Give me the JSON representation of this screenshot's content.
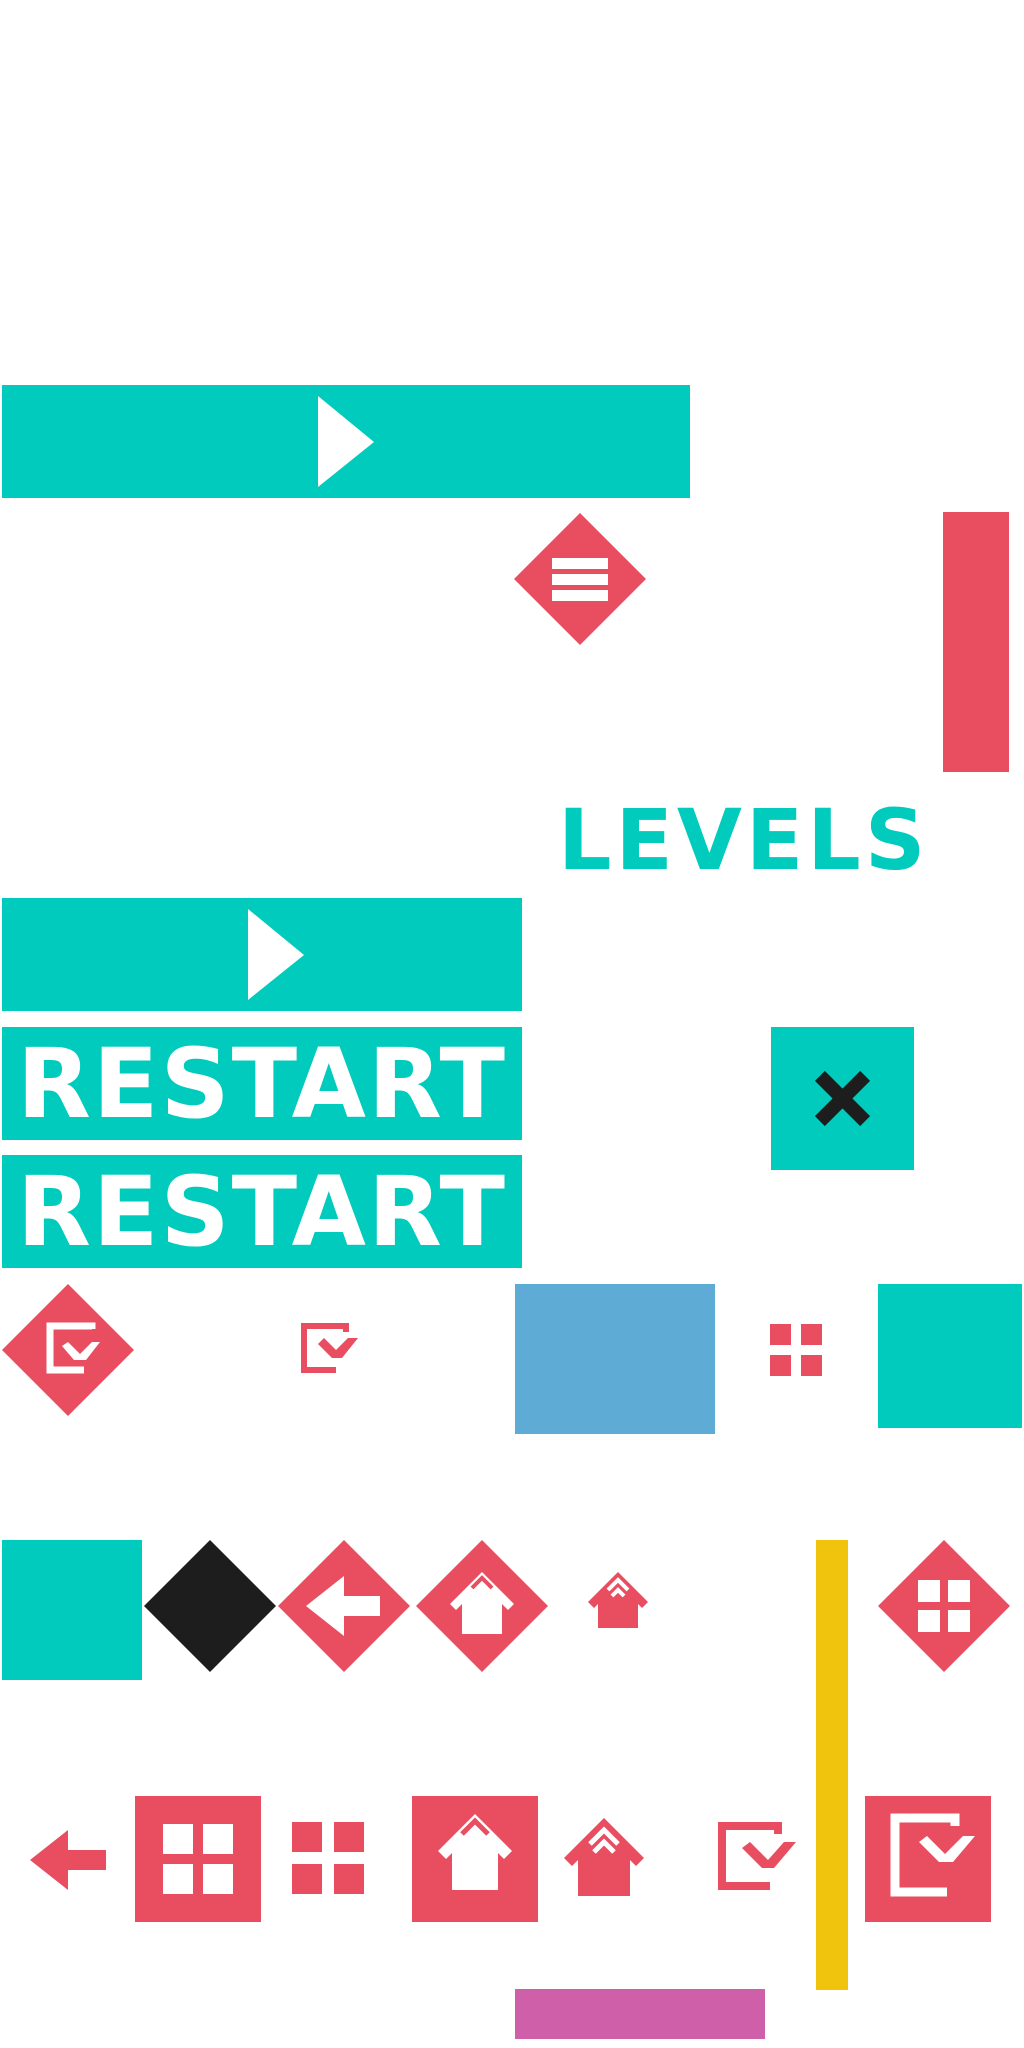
{
  "colors": {
    "teal": "#00CBBC",
    "red": "#E84D60",
    "blue": "#5EACD5",
    "yellow": "#F0C30C",
    "pink": "#D05FAA",
    "black": "#1D1D1D",
    "white": "#FFFFFF",
    "dark_icon": "#1D1D1D"
  },
  "labels": {
    "levels": "LEVELS",
    "restart_1": "RESTART",
    "restart_2": "RESTART"
  },
  "icons": [
    "play-icon",
    "menu-icon",
    "close-icon",
    "exit-icon",
    "grid-icon",
    "back-arrow-icon",
    "home-icon"
  ]
}
